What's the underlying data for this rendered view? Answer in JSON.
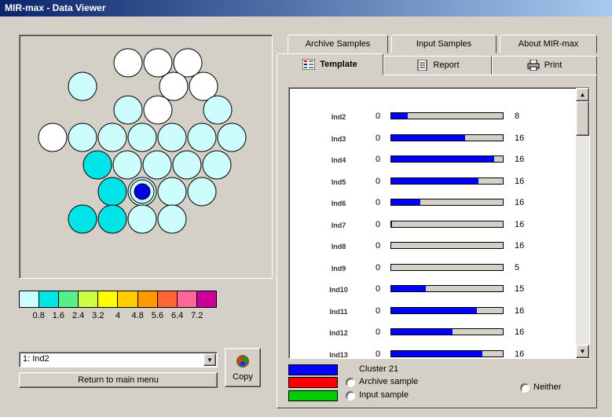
{
  "window": {
    "title": "MIR-max - Data Viewer"
  },
  "map": {
    "hex_colors": [
      "#ffffff",
      "#ccfcfc",
      "#00e4e8",
      "#00ccd8",
      "#0000e8"
    ]
  },
  "legend": {
    "colors": [
      "#ccffff",
      "#00e6e6",
      "#55ee88",
      "#ccff44",
      "#ffff00",
      "#ffcc00",
      "#ff9900",
      "#ff6633",
      "#ff6699",
      "#cc0099"
    ],
    "ticks": [
      "0.8",
      "1.6",
      "2.4",
      "3.2",
      "4",
      "4.8",
      "5.6",
      "6.4",
      "7.2"
    ]
  },
  "selector": {
    "value": "1: Ind2"
  },
  "buttons": {
    "return_label": "Return to main menu",
    "copy_label": "Copy"
  },
  "tabs": {
    "back": [
      "Archive Samples",
      "Input Samples",
      "About MIR-max"
    ],
    "front": [
      "Template",
      "Report",
      "Print"
    ]
  },
  "template_rows": [
    {
      "label": "Ind2",
      "min": "0",
      "max": "8",
      "fill": 0.15
    },
    {
      "label": "Ind3",
      "min": "0",
      "max": "16",
      "fill": 0.66
    },
    {
      "label": "Ind4",
      "min": "0",
      "max": "16",
      "fill": 0.92
    },
    {
      "label": "Ind5",
      "min": "0",
      "max": "16",
      "fill": 0.78
    },
    {
      "label": "Ind6",
      "min": "0",
      "max": "16",
      "fill": 0.26
    },
    {
      "label": "Ind7",
      "min": "0",
      "max": "16",
      "fill": 0.01
    },
    {
      "label": "Ind8",
      "min": "0",
      "max": "16",
      "fill": 0.0
    },
    {
      "label": "Ind9",
      "min": "0",
      "max": "5",
      "fill": 0.0
    },
    {
      "label": "Ind10",
      "min": "0",
      "max": "15",
      "fill": 0.31
    },
    {
      "label": "Ind11",
      "min": "0",
      "max": "16",
      "fill": 0.77
    },
    {
      "label": "Ind12",
      "min": "0",
      "max": "16",
      "fill": 0.55
    },
    {
      "label": "Ind13",
      "min": "0",
      "max": "16",
      "fill": 0.82
    }
  ],
  "key": {
    "cluster": {
      "label": "Cluster 21",
      "color": "#0000ff"
    },
    "archive": {
      "label": "Archive sample",
      "color": "#ff0000"
    },
    "input": {
      "label": "Input sample",
      "color": "#00cc00"
    },
    "neither": {
      "label": "Neither"
    }
  }
}
